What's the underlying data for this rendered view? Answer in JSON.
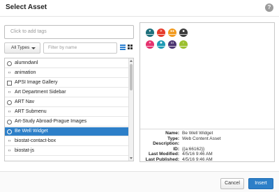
{
  "dialog": {
    "title": "Select Asset",
    "help_icon": "question-circle-icon",
    "help_glyph": "?"
  },
  "tags": {
    "placeholder": "Click to add tags"
  },
  "filters": {
    "types_label": "All Types",
    "filter_placeholder": "Filter by name",
    "list_view_icon": "list-view-icon",
    "grid_view_icon": "grid-view-icon"
  },
  "assets": {
    "items": [
      {
        "label": "alumndwnl",
        "icon": "globe-icon",
        "glyph": "⊕"
      },
      {
        "label": "animation",
        "icon": "code-icon",
        "glyph": "‹›"
      },
      {
        "label": "APSI Image Gallery",
        "icon": "image-icon",
        "glyph": "▣"
      },
      {
        "label": "Art Department Sidebar",
        "icon": "code-icon",
        "glyph": "‹›"
      },
      {
        "label": "ART Nav",
        "icon": "globe-icon",
        "glyph": "⊕"
      },
      {
        "label": "ART Submenu",
        "icon": "code-icon",
        "glyph": "‹›"
      },
      {
        "label": "Art-Study Abroad-Prague Images",
        "icon": "globe-icon",
        "glyph": "⊕"
      },
      {
        "label": "Be Well Widget",
        "icon": "globe-icon",
        "glyph": "⊕",
        "selected": true
      },
      {
        "label": "biostat-contact-box",
        "icon": "code-icon",
        "glyph": "‹›"
      },
      {
        "label": "biostat-js",
        "icon": "code-icon",
        "glyph": "‹›"
      }
    ]
  },
  "preview": {
    "thumbnails": [
      {
        "color": "#1e6f7b",
        "icon": "heart-icon",
        "glyph": "♥"
      },
      {
        "color": "#e63a2a",
        "icon": "plane-icon",
        "glyph": "✈"
      },
      {
        "color": "#f29a1e",
        "icon": "people-icon",
        "glyph": "●●"
      },
      {
        "color": "#3b3b3b",
        "icon": "briefcase-icon",
        "glyph": "■"
      },
      {
        "color": "#e5316e",
        "icon": "star-icon",
        "glyph": "✶"
      },
      {
        "color": "#1f9bb5",
        "icon": "gear-icon",
        "glyph": "✹"
      },
      {
        "color": "#4b3470",
        "icon": "group-icon",
        "glyph": "ııı"
      },
      {
        "color": "#9bc02e",
        "icon": "bulb-icon",
        "glyph": "♀"
      }
    ]
  },
  "details": {
    "rows": [
      {
        "key": "Name:",
        "value": "Be Well Widget"
      },
      {
        "key": "Type:",
        "value": "Web Content Asset"
      },
      {
        "key": "Description:",
        "value": ""
      },
      {
        "key": "ID:",
        "value": "{{a:66162}}"
      },
      {
        "key": "Last Modified:",
        "value": "4/5/16 9:46 AM"
      },
      {
        "key": "Last Published:",
        "value": "4/5/16 9:46 AM"
      }
    ]
  },
  "footer": {
    "cancel_label": "Cancel",
    "insert_label": "Insert"
  },
  "colors": {
    "accent": "#2d7fc8"
  }
}
